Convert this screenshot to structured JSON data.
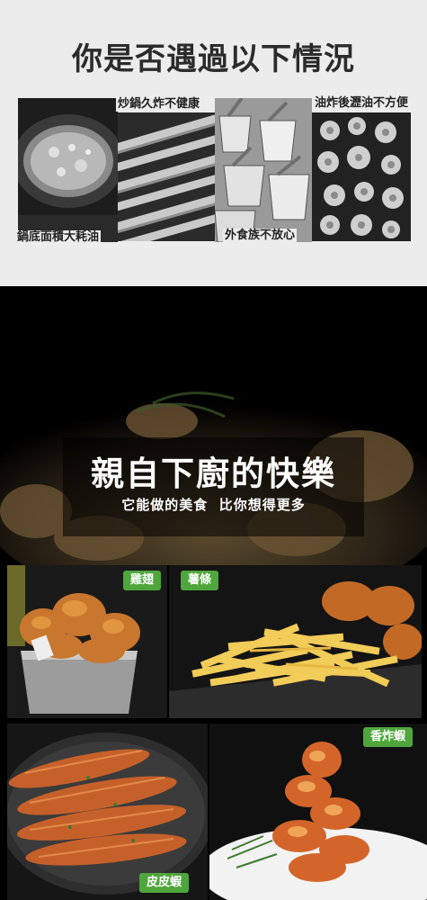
{
  "top_section": {
    "title": "你是否遇過以下情況",
    "captions": [
      "鍋底面積大耗油",
      "炒鍋久炸不健康",
      "外食族不放心",
      "油炸後瀝油不方便"
    ]
  },
  "bottom_section": {
    "title": "親自下廚的快樂",
    "subtitle": "它能做的美食  比你想得更多",
    "food_tags": [
      "雞翅",
      "薯條",
      "香炸蝦",
      "皮皮蝦"
    ]
  },
  "colors": {
    "top_background": "#ececec",
    "tag_green": "#4fa63c",
    "bottom_background": "#000000"
  }
}
